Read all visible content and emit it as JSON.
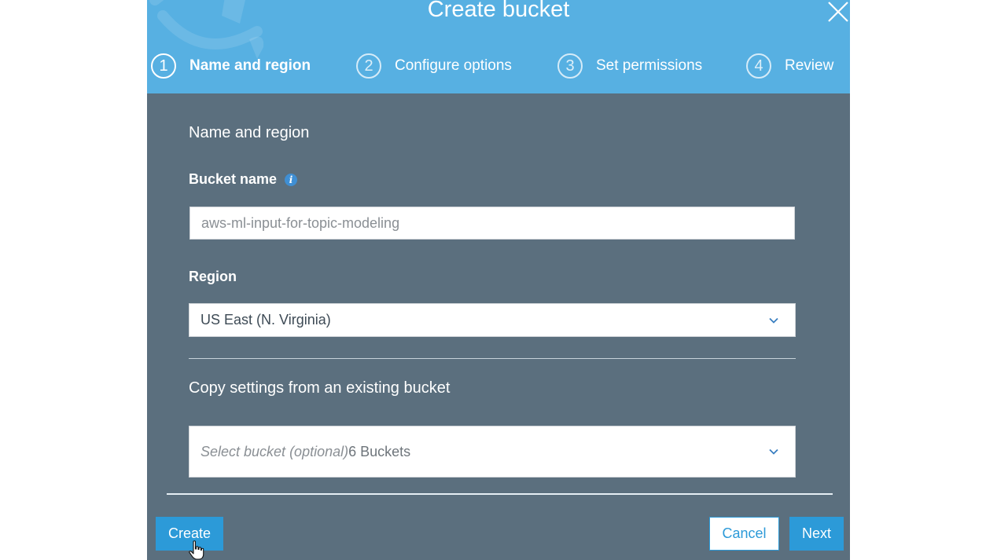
{
  "dialog": {
    "title": "Create bucket"
  },
  "steps": [
    {
      "number": "1",
      "label": "Name and region",
      "active": true
    },
    {
      "number": "2",
      "label": "Configure options",
      "active": false
    },
    {
      "number": "3",
      "label": "Set permissions",
      "active": false
    },
    {
      "number": "4",
      "label": "Review",
      "active": false
    }
  ],
  "form": {
    "section_title": "Name and region",
    "bucket_name_label": "Bucket name",
    "bucket_name_value": "aws-ml-input-for-topic-modeling",
    "region_label": "Region",
    "region_value": "US East (N. Virginia)",
    "copy_settings_title": "Copy settings from an existing bucket",
    "copy_select_placeholder": "Select bucket (optional)",
    "copy_select_count": "6 Buckets"
  },
  "footer": {
    "create_label": "Create",
    "cancel_label": "Cancel",
    "next_label": "Next"
  },
  "colors": {
    "header_bg": "#57b0e2",
    "body_bg": "#5b6f7e",
    "primary_button": "#2c9ad8"
  },
  "icons": {
    "close": "close-icon",
    "info": "info-icon",
    "chevron": "chevron-down-icon",
    "cursor": "hand-pointer-icon"
  }
}
